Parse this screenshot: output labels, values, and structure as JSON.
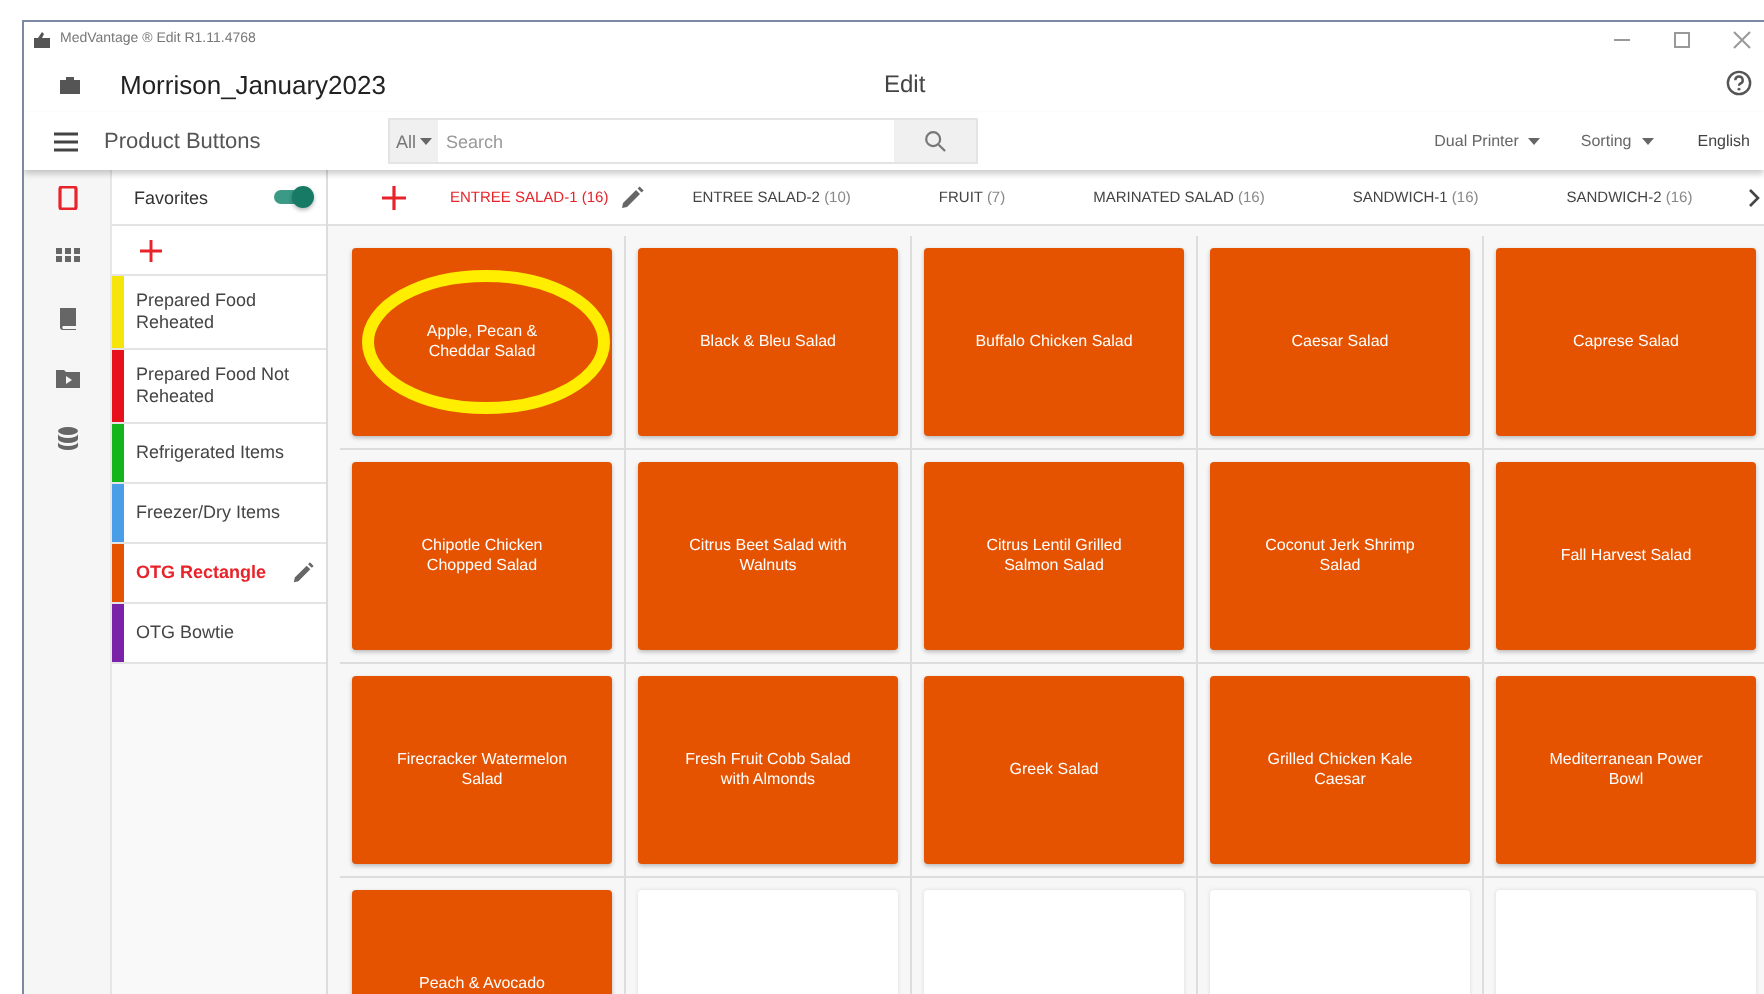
{
  "window": {
    "title": "MedVantage ® Edit R1.11.4768"
  },
  "header": {
    "title": "Morrison_January2023",
    "center": "Edit"
  },
  "toolbar": {
    "title": "Product Buttons",
    "filter": "All",
    "search": {
      "placeholder": "Search"
    },
    "menus": [
      "Dual Printer",
      "Sorting"
    ],
    "language": "English"
  },
  "rail": [
    {
      "selected": true
    },
    {
      "selected": false
    },
    {
      "selected": false
    },
    {
      "selected": false
    },
    {
      "selected": false
    }
  ],
  "favorites": {
    "label": "Favorites",
    "on": true
  },
  "categories": [
    {
      "label": "Prepared Food Reheated",
      "color": "#f5e50a",
      "selected": false
    },
    {
      "label": "Prepared Food Not Reheated",
      "color": "#e8101a",
      "selected": false
    },
    {
      "label": "Refrigerated Items",
      "color": "#12b51c",
      "selected": false
    },
    {
      "label": "Freezer/Dry Items",
      "color": "#4a9ee8",
      "selected": false
    },
    {
      "label": "OTG Rectangle",
      "color": "#e55300",
      "selected": true
    },
    {
      "label": "OTG Bowtie",
      "color": "#7a22a8",
      "selected": false
    }
  ],
  "tabs": [
    {
      "label": "ENTREE SALAD-1",
      "count": "(16)",
      "selected": true
    },
    {
      "label": "ENTREE SALAD-2",
      "count": "(10)",
      "selected": false
    },
    {
      "label": "FRUIT",
      "count": "(7)",
      "selected": false
    },
    {
      "label": "MARINATED SALAD",
      "count": "(16)",
      "selected": false
    },
    {
      "label": "SANDWICH-1",
      "count": "(16)",
      "selected": false
    },
    {
      "label": "SANDWICH-2",
      "count": "(16)",
      "selected": false
    }
  ],
  "tiles": [
    {
      "kind": "product",
      "label": "Apple, Pecan & Cheddar Salad",
      "highlighted": true
    },
    {
      "kind": "product",
      "label": "Black & Bleu Salad",
      "highlighted": false
    },
    {
      "kind": "product",
      "label": "Buffalo Chicken Salad",
      "highlighted": false
    },
    {
      "kind": "product",
      "label": "Caesar Salad",
      "highlighted": false
    },
    {
      "kind": "product",
      "label": "Caprese Salad",
      "highlighted": false
    },
    {
      "kind": "product",
      "label": "Chipotle Chicken Chopped Salad",
      "highlighted": false
    },
    {
      "kind": "product",
      "label": "Citrus Beet Salad with Walnuts",
      "highlighted": false
    },
    {
      "kind": "product",
      "label": "Citrus Lentil Grilled Salmon Salad",
      "highlighted": false
    },
    {
      "kind": "product",
      "label": "Coconut Jerk Shrimp Salad",
      "highlighted": false
    },
    {
      "kind": "product",
      "label": "Fall Harvest Salad",
      "highlighted": false
    },
    {
      "kind": "product",
      "label": "Firecracker Watermelon Salad",
      "highlighted": false
    },
    {
      "kind": "product",
      "label": "Fresh Fruit Cobb Salad with Almonds",
      "highlighted": false
    },
    {
      "kind": "product",
      "label": "Greek Salad",
      "highlighted": false
    },
    {
      "kind": "product",
      "label": "Grilled Chicken Kale Caesar",
      "highlighted": false
    },
    {
      "kind": "product",
      "label": "Mediterranean Power Bowl",
      "highlighted": false
    },
    {
      "kind": "product",
      "label": "Peach & Avocado",
      "highlighted": false
    },
    {
      "kind": "empty"
    },
    {
      "kind": "empty"
    },
    {
      "kind": "empty"
    },
    {
      "kind": "empty"
    }
  ]
}
